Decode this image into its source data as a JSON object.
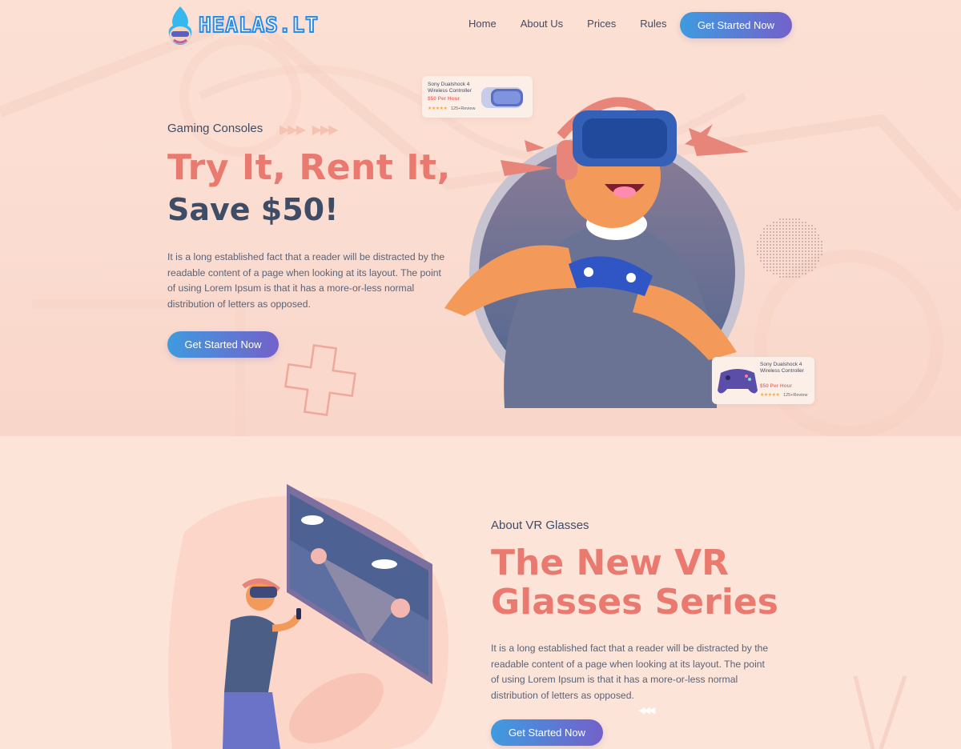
{
  "brand": {
    "logo_text": "HEALAS.LT"
  },
  "nav": {
    "items": [
      "Home",
      "About Us",
      "Prices",
      "Rules"
    ],
    "cta_label": "Get Started Now"
  },
  "hero": {
    "eyebrow": "Gaming Consoles",
    "title_line1": "Try It, Rent It,",
    "title_line2": "Save $50!",
    "paragraph": "It is a long established fact that a reader will be distracted by the readable content of a page when looking at its layout. The point of using Lorem Ipsum is that it has a more-or-less normal distribution of letters as opposed.",
    "cta_label": "Get Started Now"
  },
  "product_cards": [
    {
      "title": "Sony Dualshock 4 Wireless Controller",
      "price": "$50 Per Hour",
      "stars": "★★★★★",
      "reviews": "125+Review"
    },
    {
      "title": "Sony Dualshock 4 Wireless Controller",
      "price": "$50 Per Hour",
      "stars": "★★★★★",
      "reviews": "125+Review"
    }
  ],
  "about": {
    "eyebrow": "About VR Glasses",
    "title": "The New VR Glasses Series",
    "paragraph": "It is a long established fact that a reader will be distracted by the readable content of a page when looking at its layout. The point of using Lorem Ipsum is that it has a more-or-less normal distribution of letters as opposed.",
    "cta_label": "Get Started Now"
  },
  "colors": {
    "accent_coral": "#ea7a70",
    "text_navy": "#3f4c66",
    "button_gradient_start": "#3f9be0",
    "button_gradient_end": "#7361c9",
    "background": "#fde6da"
  },
  "icons": [
    "flame-mascot-logo-icon",
    "play-arrows-icon",
    "vr-headset-icon",
    "gamepad-icon",
    "plus-outline-icon",
    "dot-grid-icon"
  ]
}
